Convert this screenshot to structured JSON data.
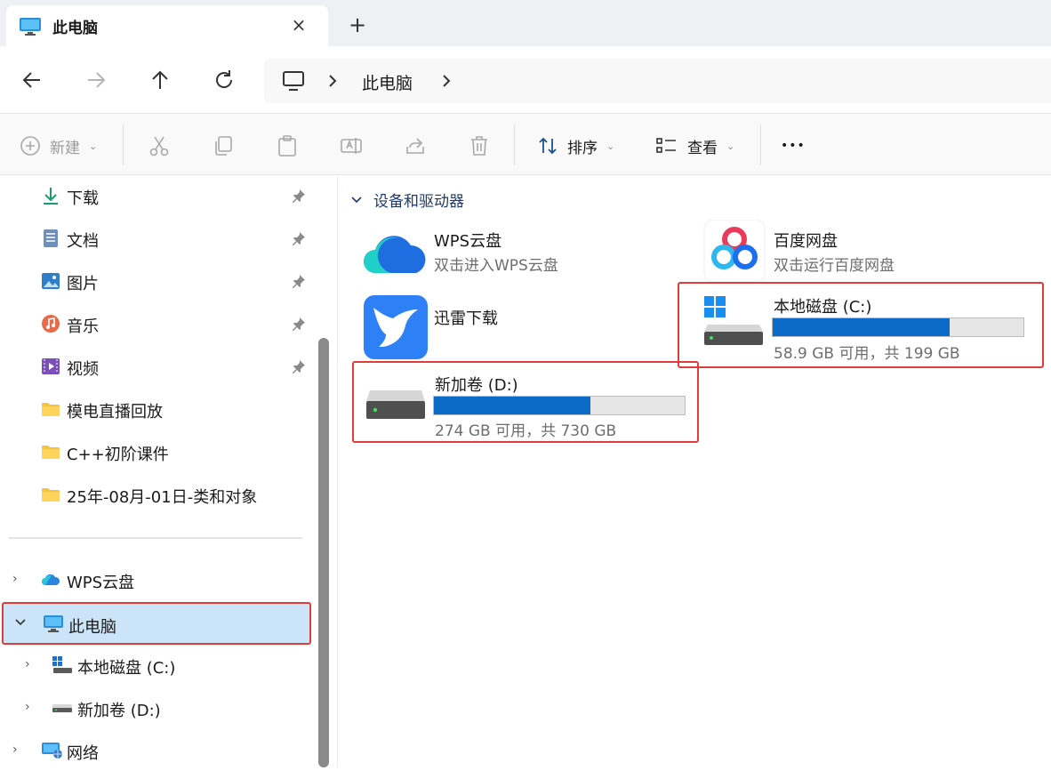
{
  "tab": {
    "title": "此电脑",
    "close_icon": "×",
    "new_tab_icon": "+"
  },
  "address": {
    "crumb": "此电脑"
  },
  "toolbar": {
    "new_label": "新建",
    "sort_label": "排序",
    "view_label": "查看",
    "more_icon": "•••"
  },
  "sidebar": {
    "quick_access": [
      {
        "label": "下载",
        "icon": "download-icon",
        "pinned": true
      },
      {
        "label": "文档",
        "icon": "document-icon",
        "pinned": true
      },
      {
        "label": "图片",
        "icon": "picture-icon",
        "pinned": true
      },
      {
        "label": "音乐",
        "icon": "music-icon",
        "pinned": true
      },
      {
        "label": "视频",
        "icon": "video-icon",
        "pinned": true
      },
      {
        "label": "模电直播回放",
        "icon": "folder-icon",
        "pinned": false
      },
      {
        "label": "C++初阶课件",
        "icon": "folder-icon",
        "pinned": false
      },
      {
        "label": "25年-08月-01日-类和对象",
        "icon": "folder-icon",
        "pinned": false
      }
    ],
    "tree": [
      {
        "label": "WPS云盘",
        "icon": "cloud-icon",
        "arrow": "›"
      },
      {
        "label": "此电脑",
        "icon": "computer-icon",
        "arrow": "⌄"
      },
      {
        "label": "本地磁盘 (C:)",
        "icon": "windows-drive-icon",
        "arrow": "›"
      },
      {
        "label": "新加卷 (D:)",
        "icon": "drive-icon",
        "arrow": "›"
      },
      {
        "label": "网络",
        "icon": "network-icon",
        "arrow": "›"
      }
    ]
  },
  "content": {
    "group_title": "设备和驱动器",
    "items": [
      {
        "name": "WPS云盘",
        "sub": "双击进入WPS云盘",
        "icon": "wps-cloud-icon"
      },
      {
        "name": "百度网盘",
        "sub": "双击运行百度网盘",
        "icon": "baidu-netdisk-icon"
      },
      {
        "name": "迅雷下载",
        "sub": "",
        "icon": "xunlei-icon"
      }
    ],
    "drives": [
      {
        "name": "本地磁盘 (C:)",
        "sub": "58.9 GB 可用，共 199 GB",
        "used_fraction": 0.704,
        "icon": "windows-drive-icon"
      },
      {
        "name": "新加卷 (D:)",
        "sub": "274 GB 可用，共 730 GB",
        "used_fraction": 0.625,
        "icon": "drive-icon"
      }
    ]
  },
  "colors": {
    "accent": "#0b6bc7",
    "highlight": "#e03c3c",
    "selection": "#cce4f7"
  }
}
